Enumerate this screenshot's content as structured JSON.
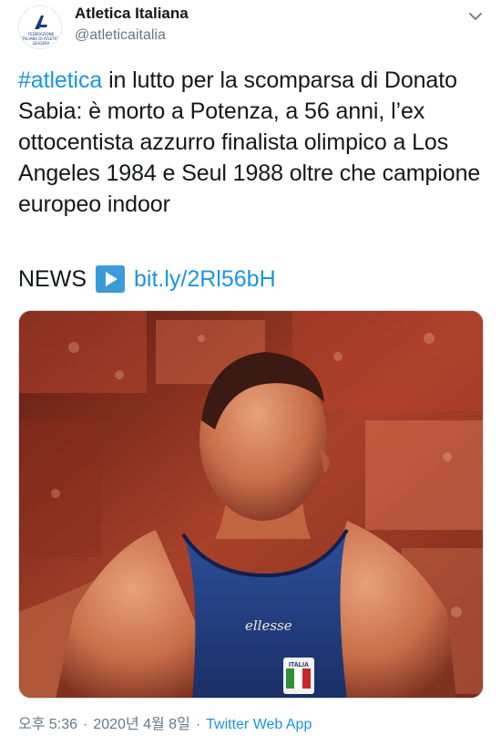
{
  "author": {
    "name": "Atletica Italiana",
    "handle": "@atleticaitalia",
    "avatar_text": "FEDERAZIONE ITALIANA DI ATLETICA LEGGERA",
    "avatar_icon": "fidal-logo-icon"
  },
  "tweet": {
    "hashtag": "#atletica",
    "text": " in lutto per la scomparsa di Donato Sabia: è morto a Potenza, a 56 anni, l’ex ottocentista azzurro finalista olimpico a Los Angeles 1984 e Seul 1988 oltre che campione europeo indoor",
    "news_label": "NEWS",
    "news_icon": "play-button-icon",
    "link": "bit.ly/2Rl56bH",
    "media_label": "ellesse",
    "badge_label": "ITALIA"
  },
  "meta": {
    "time": "오후 5:36",
    "separator": "·",
    "date": "2020년 4월 8일",
    "source": "Twitter Web App"
  },
  "colors": {
    "link": "#1b95e0",
    "text": "#14171a",
    "secondary": "#657786"
  }
}
